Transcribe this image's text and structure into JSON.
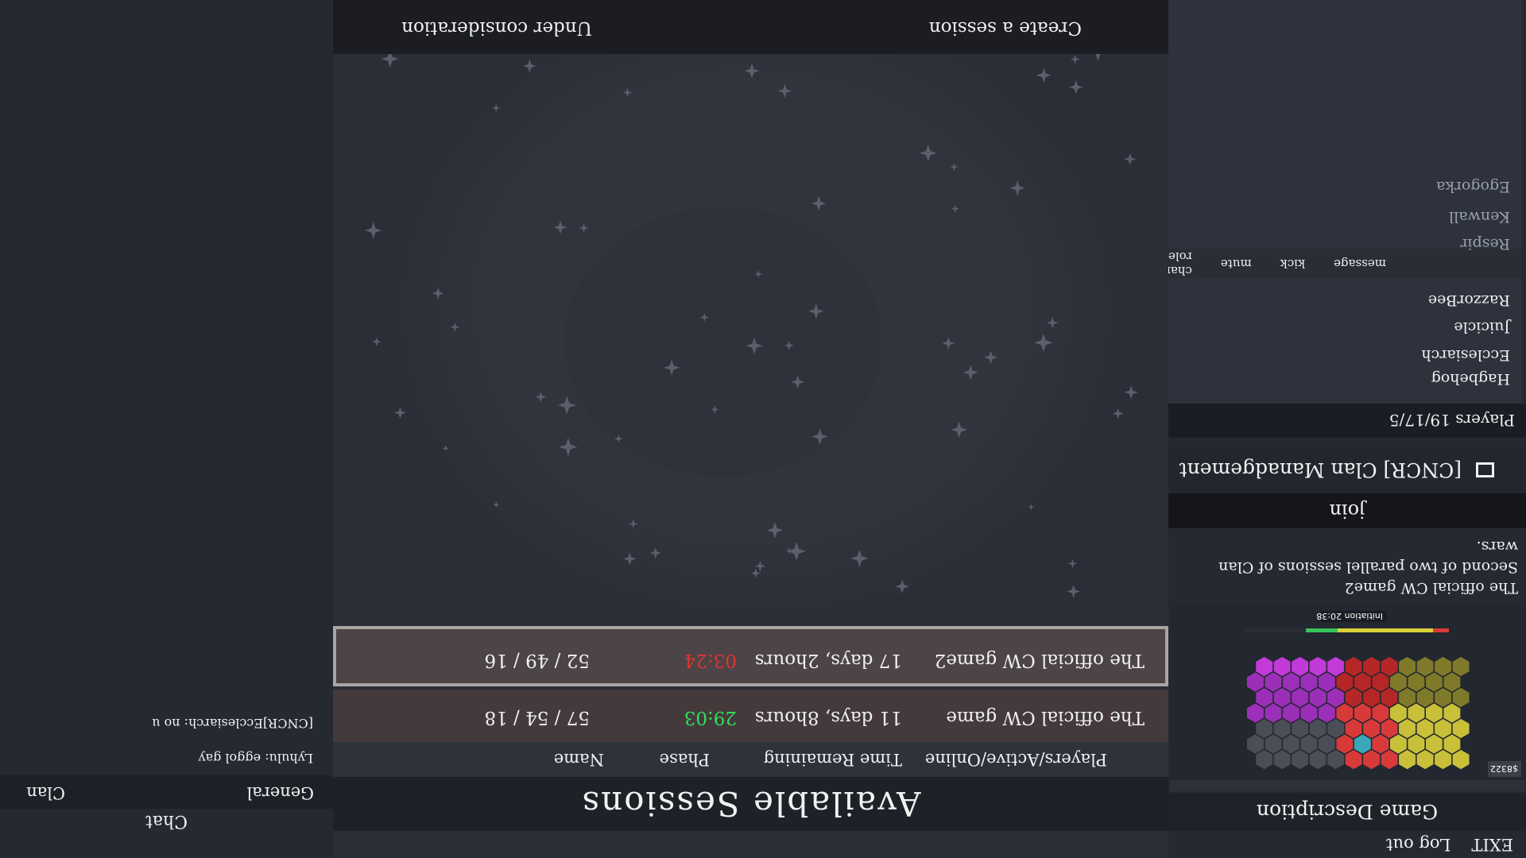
{
  "topbar": {
    "exit": "EXIT",
    "logout": "Log out"
  },
  "game_description": {
    "header": "Game Description",
    "title": "The official CW game2",
    "text": "Second of two parallel sessions of Clan wars.",
    "join": "join",
    "thumbnail": {
      "money": "$8322",
      "timer": "Initiation 20:38"
    }
  },
  "clan": {
    "management": "[CNCR] Clan Manadgement",
    "players": "Players 19/17/5",
    "members": [
      "Hagbehog",
      "Ecclesiarch",
      "Juicicle",
      "RazzorBee",
      "Respir",
      "Kenwall",
      "Egogorka"
    ],
    "actions": [
      "message",
      "kick",
      "mute",
      "change role"
    ]
  },
  "sessions": {
    "header": "Available Sessions",
    "columns": [
      "Name",
      "Time Remaining",
      "Phase",
      "Players/Active/Online"
    ],
    "rows": [
      {
        "name": "The official CW game",
        "time": "11 days, 8hours",
        "phase": "29:03",
        "players": "57 / 54 / 18",
        "phase_color": "#2ee05a"
      },
      {
        "name": "The official CW game2",
        "time": "17 days, 2hours",
        "phase": "03:24",
        "players": "52 / 49 / 16",
        "phase_color": "#e03434"
      }
    ],
    "create": "Create a session",
    "under_consideration": "Under consideration"
  },
  "chat": {
    "label": "Chat",
    "tabs": [
      "General",
      "Clan"
    ],
    "messages": [
      "Lyhulu: eggol gay",
      "[CNCR]Ecclesiarch: no u"
    ]
  }
}
